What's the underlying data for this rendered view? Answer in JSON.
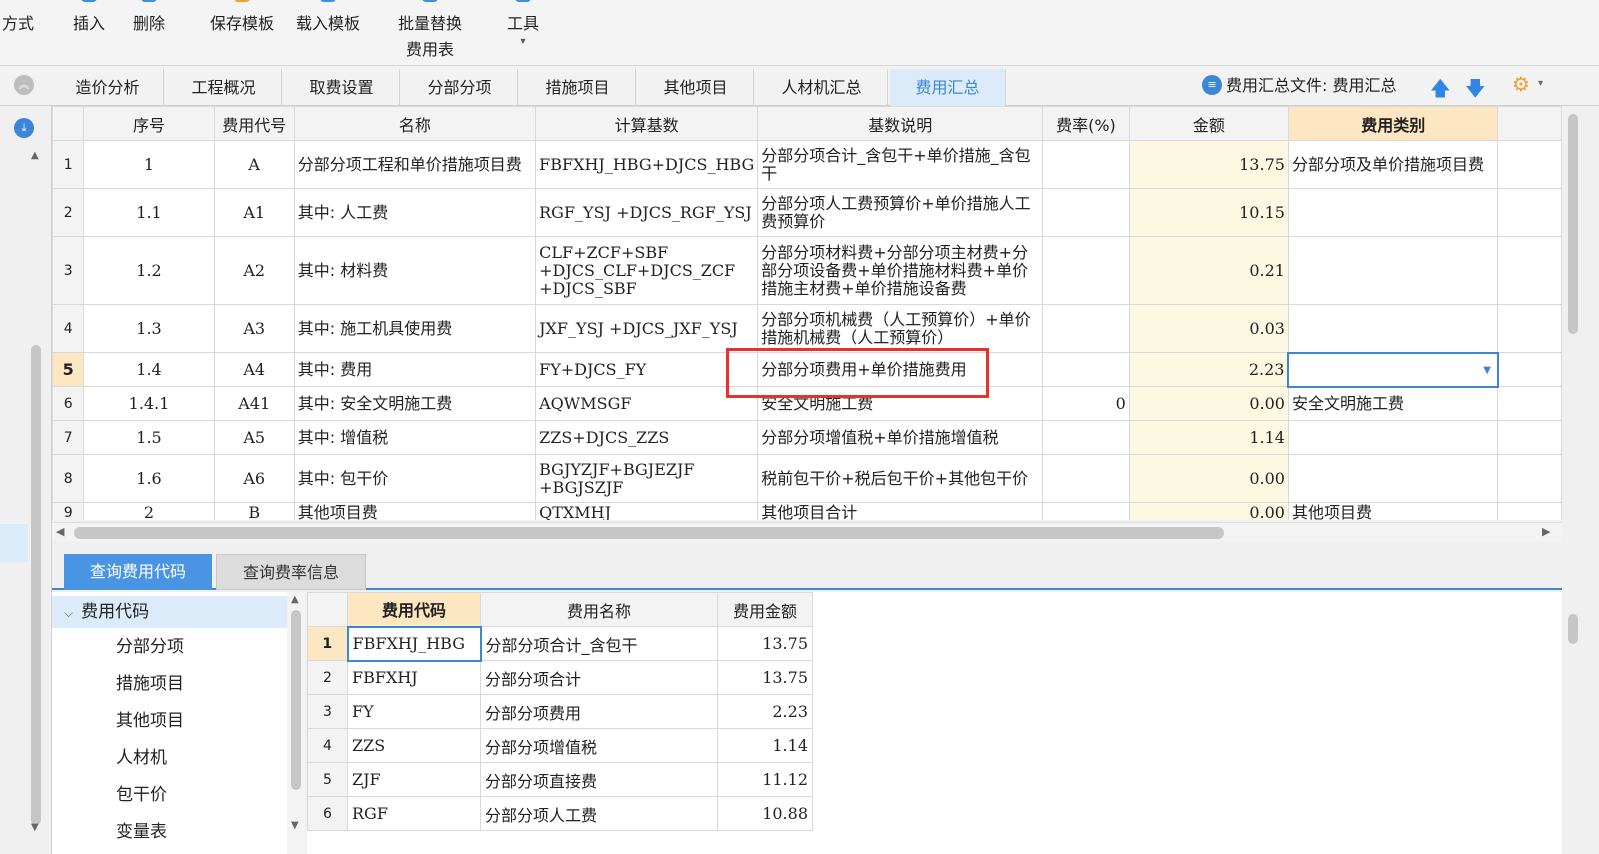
{
  "toolbar": {
    "buttons": [
      {
        "label": "方式",
        "label2": ""
      },
      {
        "label": "插入",
        "label2": ""
      },
      {
        "label": "删除",
        "label2": ""
      },
      {
        "label": "保存模板",
        "label2": ""
      },
      {
        "label": "载入模板",
        "label2": ""
      },
      {
        "label": "批量替换",
        "label2": "费用表"
      },
      {
        "label": "工具",
        "label2": "▾"
      }
    ]
  },
  "tabs": [
    "造价分析",
    "工程概况",
    "取费设置",
    "分部分项",
    "措施项目",
    "其他项目",
    "人材机汇总",
    "费用汇总"
  ],
  "active_tab": "费用汇总",
  "summary_file": "费用汇总文件: 费用汇总",
  "main_grid": {
    "headers": [
      "序号",
      "费用代号",
      "名称",
      "计算基数",
      "基数说明",
      "费率(%)",
      "金额",
      "费用类别"
    ],
    "rows": [
      {
        "n": "1",
        "seq": "1",
        "code": "A",
        "name": "分部分项工程和单价措施项目费",
        "base": "FBFXHJ_HBG+DJCS_HBG",
        "desc": "分部分项合计_含包干+单价措施_含包干",
        "rate": "",
        "amount": "13.75",
        "category": "分部分项及单价措施项目费"
      },
      {
        "n": "2",
        "seq": "1.1",
        "code": "A1",
        "name": "其中: 人工费",
        "base": "RGF_YSJ +DJCS_RGF_YSJ",
        "desc": "分部分项人工费预算价+单价措施人工费预算价",
        "rate": "",
        "amount": "10.15",
        "category": ""
      },
      {
        "n": "3",
        "seq": "1.2",
        "code": "A2",
        "name": "其中: 材料费",
        "base": "CLF+ZCF+SBF +DJCS_CLF+DJCS_ZCF +DJCS_SBF",
        "desc": "分部分项材料费+分部分项主材费+分部分项设备费+单价措施材料费+单价措施主材费+单价措施设备费",
        "rate": "",
        "amount": "0.21",
        "category": ""
      },
      {
        "n": "4",
        "seq": "1.3",
        "code": "A3",
        "name": "其中: 施工机具使用费",
        "base": "JXF_YSJ +DJCS_JXF_YSJ",
        "desc": "分部分项机械费（人工预算价）+单价措施机械费（人工预算价）",
        "rate": "",
        "amount": "0.03",
        "category": ""
      },
      {
        "n": "5",
        "seq": "1.4",
        "code": "A4",
        "name": "其中: 费用",
        "base": "FY+DJCS_FY",
        "desc": "分部分项费用+单价措施费用",
        "rate": "",
        "amount": "2.23",
        "category": ""
      },
      {
        "n": "6",
        "seq": "1.4.1",
        "code": "A41",
        "name": "其中: 安全文明施工费",
        "base": "AQWMSGF",
        "desc": "安全文明施工费",
        "rate": "0",
        "amount": "0.00",
        "category": "安全文明施工费"
      },
      {
        "n": "7",
        "seq": "1.5",
        "code": "A5",
        "name": "其中: 增值税",
        "base": "ZZS+DJCS_ZZS",
        "desc": "分部分项增值税+单价措施增值税",
        "rate": "",
        "amount": "1.14",
        "category": ""
      },
      {
        "n": "8",
        "seq": "1.6",
        "code": "A6",
        "name": "其中: 包干价",
        "base": "BGJYZJF+BGJEZJF +BGJSZJF",
        "desc": "税前包干价+税后包干价+其他包干价",
        "rate": "",
        "amount": "0.00",
        "category": ""
      },
      {
        "n": "9",
        "seq": "2",
        "code": "B",
        "name": "其他项目费",
        "base": "QTXMHJ",
        "desc": "其他项目合计",
        "rate": "",
        "amount": "0.00",
        "category": "其他项目费"
      }
    ]
  },
  "bottom_tabs": [
    "查询费用代码",
    "查询费率信息"
  ],
  "tree": {
    "root": "费用代码",
    "items": [
      "分部分项",
      "措施项目",
      "其他项目",
      "人材机",
      "包干价",
      "变量表"
    ]
  },
  "code_grid": {
    "headers": [
      "费用代码",
      "费用名称",
      "费用金额"
    ],
    "rows": [
      {
        "n": "1",
        "code": "FBFXHJ_HBG",
        "name": "分部分项合计_含包干",
        "amount": "13.75"
      },
      {
        "n": "2",
        "code": "FBFXHJ",
        "name": "分部分项合计",
        "amount": "13.75"
      },
      {
        "n": "3",
        "code": "FY",
        "name": "分部分项费用",
        "amount": "2.23"
      },
      {
        "n": "4",
        "code": "ZZS",
        "name": "分部分项增值税",
        "amount": "1.14"
      },
      {
        "n": "5",
        "code": "ZJF",
        "name": "分部分项直接费",
        "amount": "11.12"
      },
      {
        "n": "6",
        "code": "RGF",
        "name": "分部分项人工费",
        "amount": "10.88"
      }
    ]
  },
  "colors": {
    "accent": "#3b86d8",
    "highlight_header": "#fde6c2",
    "amount_bg": "#fdf8e1",
    "red_box": "#e8312b"
  }
}
